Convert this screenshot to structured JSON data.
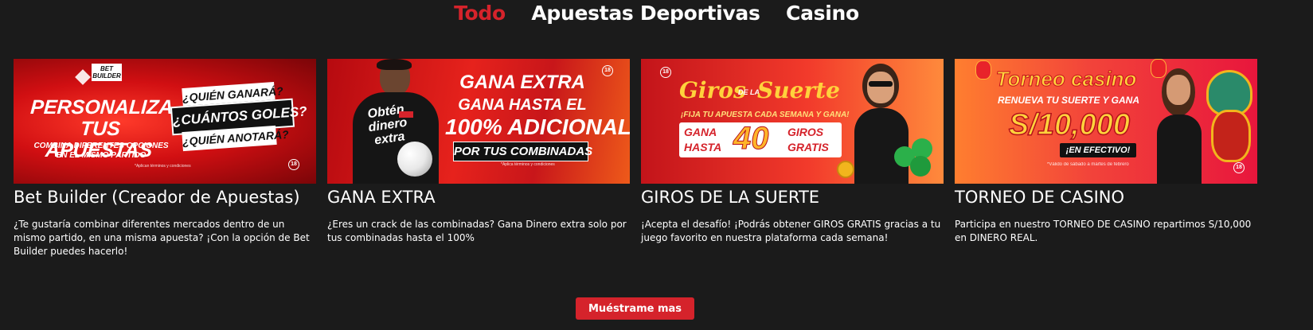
{
  "tabs": [
    {
      "label": "Todo",
      "active": true
    },
    {
      "label": "Apuestas Deportivas",
      "active": false
    },
    {
      "label": "Casino",
      "active": false
    }
  ],
  "cards": [
    {
      "title": "Bet Builder (Creador de Apuestas)",
      "description": "¿Te gustaría combinar diferentes mercados dentro de un mismo partido, en una misma apuesta? ¡Con la opción de Bet Builder puedes hacerlo!",
      "banner": {
        "logo": "BET BUILDER",
        "headline": "PERSONALIZA TUS APUESTAS",
        "subline": "COMBINA DIFERENTES OPCIONES EN EL MISMO PARTIDO",
        "q1": "¿QUIÉN GANARÁ?",
        "q2": "¿CUÁNTOS GOLES?",
        "q3": "¿QUIÉN ANOTARÁ?",
        "fine_print": "*Aplican términos y condiciones",
        "age_badge": "18"
      }
    },
    {
      "title": "GANA EXTRA",
      "description": "¿Eres un crack de las combinadas? Gana Dinero extra solo por tus combinadas hasta el 100%",
      "banner": {
        "shirt": "Obtén dinero extra",
        "line1": "GANA EXTRA",
        "line2": "GANA HASTA EL",
        "line3": "100% ADICIONAL",
        "line4": "POR TUS COMBINADAS",
        "fine_print": "*Aplica términos y condiciones",
        "age_badge": "18"
      }
    },
    {
      "title": "GIROS DE LA SUERTE",
      "description": "¡Acepta el desafío! ¡Podrás obtener GIROS GRATIS gracias a tu juego favorito en nuestra plataforma cada semana!",
      "banner": {
        "logo_a": "Giros",
        "logo_b": "DE LA",
        "logo_c": "Suerte",
        "tagline": "¡FIJA TU APUESTA CADA SEMANA Y GANA!",
        "gana": "GANA",
        "hasta": "HASTA",
        "number": "40",
        "giros": "GIROS",
        "gratis": "GRATIS",
        "age_badge": "18"
      }
    },
    {
      "title": "TORNEO DE CASINO",
      "description": "Participa en nuestro TORNEO DE CASINO repartimos S/10,000 en DINERO REAL.",
      "banner": {
        "logo": "Torneo casino",
        "tagline": "RENUEVA TU SUERTE Y GANA",
        "amount": "S/10,000",
        "cash": "¡EN EFECTIVO!",
        "fine_print": "*Válido de sábado a martes de febrero",
        "age_badge": "18"
      }
    }
  ],
  "more_button": "Muéstrame mas",
  "colors": {
    "accent": "#d5232b",
    "background": "#1b1b1b"
  }
}
